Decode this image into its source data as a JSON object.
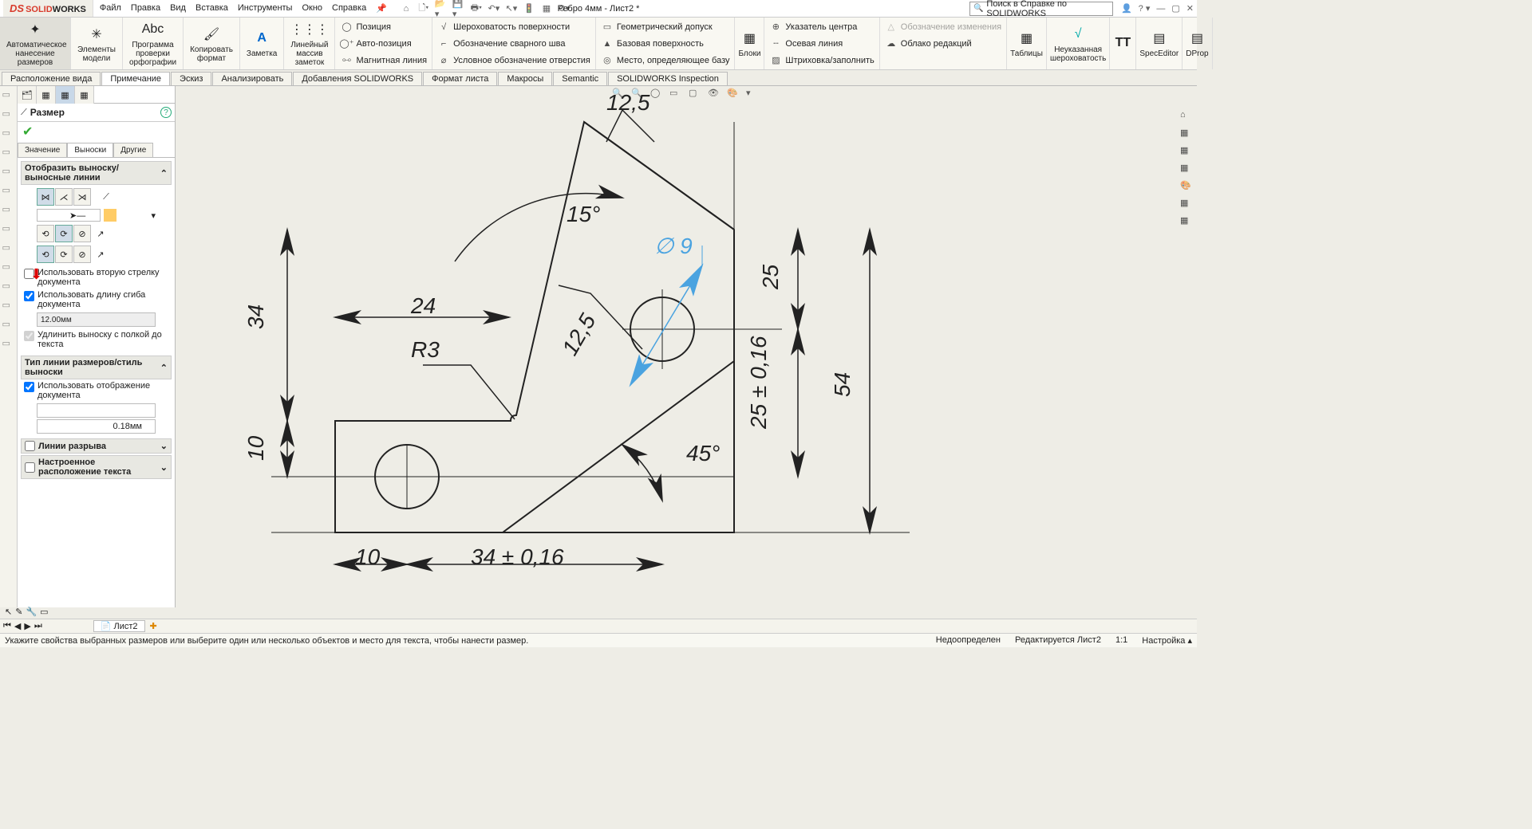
{
  "app": {
    "brand_ds": "DS",
    "brand_solid": "SOLID",
    "brand_works": "WORKS",
    "title": "Ребро 4мм - Лист2 *",
    "search_placeholder": "Поиск в Справке по SOLIDWORKS"
  },
  "menu": [
    "Файл",
    "Правка",
    "Вид",
    "Вставка",
    "Инструменты",
    "Окно",
    "Справка"
  ],
  "ribbon": {
    "g1": "Автоматическое\nнанесение размеров",
    "g2": "Элементы\nмодели",
    "g3": "Программа\nпроверки\nорфографии",
    "g4": "Копировать\nформат",
    "g5": "Заметка",
    "g6": "Линейный\nмассив заметок",
    "col1": [
      "Позиция",
      "Авто-позиция",
      "Магнитная линия"
    ],
    "col2": [
      "Шероховатость поверхности",
      "Обозначение сварного шва",
      "Условное обозначение отверстия"
    ],
    "col3": [
      "Геометрический допуск",
      "Базовая поверхность",
      "Место, определяющее базу"
    ],
    "g7": "Блоки",
    "col4": [
      "Указатель центра",
      "Осевая линия",
      "Штриховка/заполнить"
    ],
    "col5": [
      "Обозначение изменения",
      "Облако редакций"
    ],
    "g8": "Таблицы",
    "g9": "Неуказанная\nшероховатость",
    "g10": "TT",
    "g11": "SpecEditor",
    "g12": "DProp"
  },
  "tabs": [
    "Расположение вида",
    "Примечание",
    "Эскиз",
    "Анализировать",
    "Добавления SOLIDWORKS",
    "Формат листа",
    "Макросы",
    "Semantic",
    "SOLIDWORKS Inspection"
  ],
  "tabs_active": 1,
  "panel": {
    "title": "Размер",
    "subtabs": [
      "Значение",
      "Выноски",
      "Другие"
    ],
    "subtabs_active": 1,
    "sec1": "Отобразить выноску/выносные линии",
    "chk1": "Использовать вторую стрелку документа",
    "chk2": "Использовать длину сгиба документа",
    "val1": "12.00мм",
    "chk3": "Удлинить выноску с полкой до текста",
    "sec2": "Тип линии размеров/стиль выноски",
    "chk4": "Использовать отображение документа",
    "val2": "0.18мм",
    "sec3": "Линии разрыва",
    "sec4": "Настроенное расположение текста"
  },
  "drawing": {
    "d1": "12,5",
    "d2": "∅ 9",
    "d3": "15°",
    "d4": "24",
    "d5": "R3",
    "d6": "12,5",
    "d7": "34",
    "d8": "10",
    "d9": "10",
    "d10": "34 ± 0,16",
    "d11": "45°",
    "d12": "25",
    "d13": "25 ± 0,16",
    "d14": "54"
  },
  "sheet": "Лист2",
  "status": {
    "hint": "Укажите свойства выбранных размеров или выберите один или несколько объектов и место для текста, чтобы нанести размер.",
    "s1": "Недоопределен",
    "s2": "Редактируется Лист2",
    "s3": "1:1",
    "s4": "Настройка"
  }
}
